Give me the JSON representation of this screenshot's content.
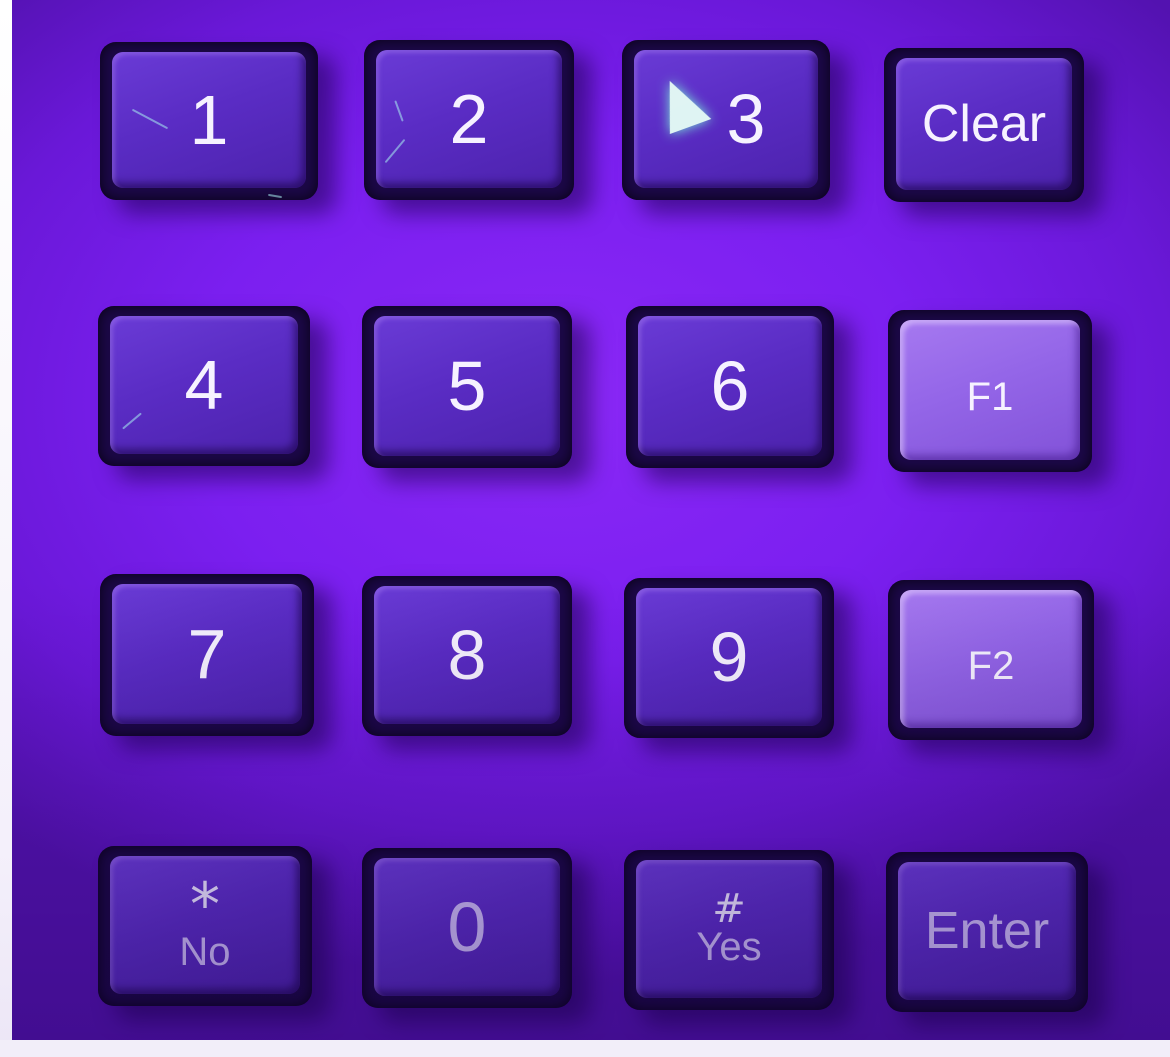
{
  "keypad": {
    "rows": [
      [
        {
          "label": "1"
        },
        {
          "label": "2"
        },
        {
          "label": "3"
        },
        {
          "label": "Clear"
        }
      ],
      [
        {
          "label": "4"
        },
        {
          "label": "5"
        },
        {
          "label": "6"
        },
        {
          "label": "F1"
        }
      ],
      [
        {
          "label": "7"
        },
        {
          "label": "8"
        },
        {
          "label": "9"
        },
        {
          "label": "F2"
        }
      ],
      [
        {
          "symbol": "*",
          "label": "No"
        },
        {
          "label": "0"
        },
        {
          "symbol": "#",
          "label": "Yes"
        },
        {
          "label": "Enter"
        }
      ]
    ]
  },
  "colors": {
    "background": "#7b1ff0",
    "key": "#5a2cc4",
    "function_key": "#9466e8",
    "legend": "#f6f2ff"
  }
}
